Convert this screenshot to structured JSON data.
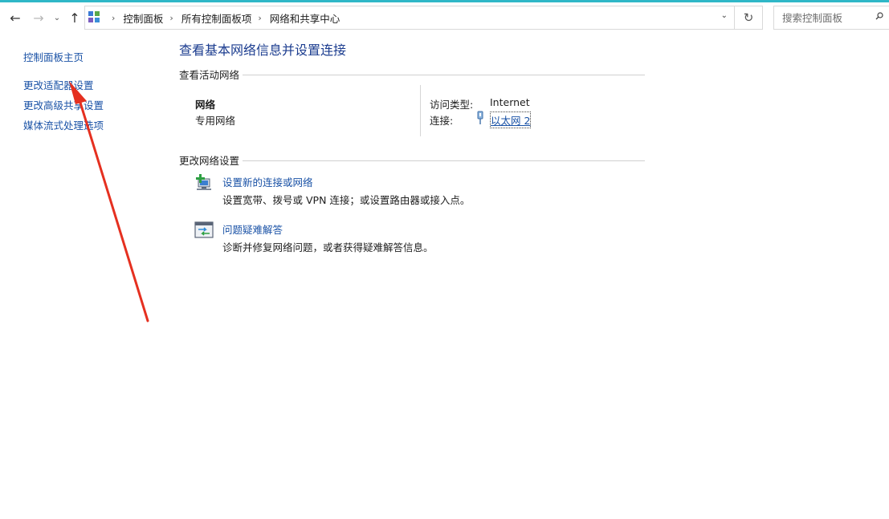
{
  "window": {
    "accent_color": "#2fb7c7"
  },
  "navigation": {
    "back_icon": "back-arrow-icon",
    "forward_icon": "forward-arrow-icon",
    "recent_icon": "chevron-down-icon",
    "up_icon": "up-arrow-icon"
  },
  "address_bar": {
    "breadcrumbs": [
      "控制面板",
      "所有控制面板项",
      "网络和共享中心"
    ],
    "separator": "›",
    "dropdown_icon": "chevron-down-icon",
    "refresh_icon": "refresh-icon"
  },
  "search": {
    "placeholder": "搜索控制面板",
    "value": ""
  },
  "sidebar": {
    "items": [
      {
        "label": "控制面板主页"
      },
      {
        "label": "更改适配器设置"
      },
      {
        "label": "更改高级共享设置"
      },
      {
        "label": "媒体流式处理选项"
      }
    ]
  },
  "main": {
    "title": "查看基本网络信息并设置连接",
    "active_networks": {
      "heading": "查看活动网络",
      "network_name": "网络",
      "network_type": "专用网络",
      "access_type_label": "访问类型:",
      "access_type_value": "Internet",
      "connections_label": "连接:",
      "connection_name": "以太网 2"
    },
    "change_settings": {
      "heading": "更改网络设置",
      "tasks": [
        {
          "link": "设置新的连接或网络",
          "description": "设置宽带、拨号或 VPN 连接；或设置路由器或接入点。",
          "icon": "new-connection-icon"
        },
        {
          "link": "问题疑难解答",
          "description": "诊断并修复网络问题，或者获得疑难解答信息。",
          "icon": "troubleshoot-icon"
        }
      ]
    }
  },
  "annotation": {
    "arrow_color": "#e53020"
  },
  "colors": {
    "link": "#1a52a6",
    "title": "#1b3c8f",
    "divider": "#d0d0d0"
  }
}
